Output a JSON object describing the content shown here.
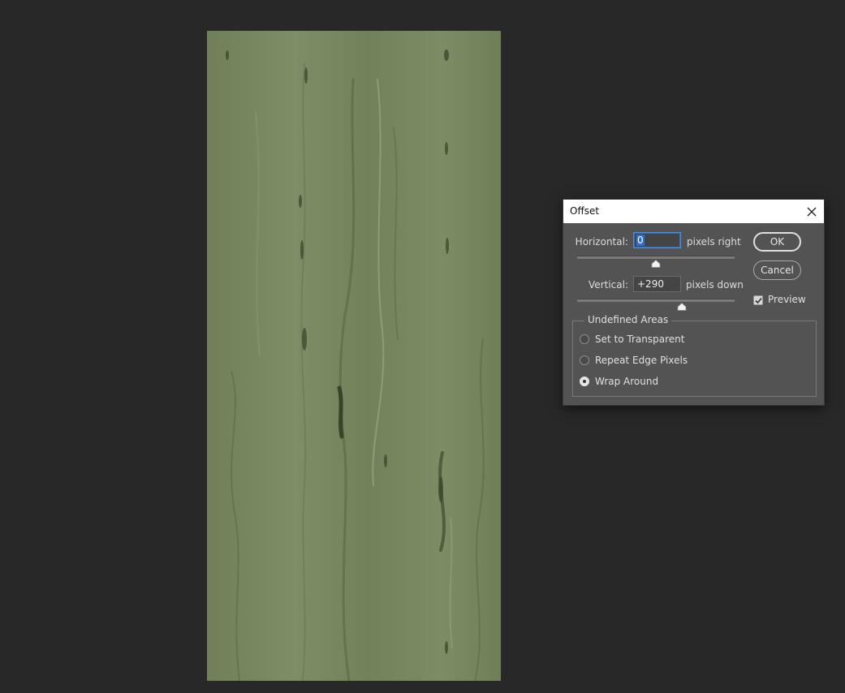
{
  "dialog": {
    "title": "Offset",
    "horizontal": {
      "label": "Horizontal:",
      "value": "0",
      "unit": "pixels right"
    },
    "vertical": {
      "label": "Vertical:",
      "value": "+290",
      "unit": "pixels down"
    },
    "ok_label": "OK",
    "cancel_label": "Cancel",
    "preview": {
      "label": "Preview",
      "checked": true
    },
    "undefined_areas": {
      "title": "Undefined Areas",
      "options": [
        {
          "label": "Set to Transparent",
          "selected": false
        },
        {
          "label": "Repeat Edge Pixels",
          "selected": false
        },
        {
          "label": "Wrap Around",
          "selected": true
        }
      ]
    }
  },
  "icons": {
    "close": "close-icon",
    "check": "checkmark-icon",
    "slider_thumb": "slider-thumb-icon"
  },
  "colors": {
    "workspace": "#282828",
    "canvas_texture": "#77875f",
    "dialog_bg": "#535353",
    "focus_accent": "#4a90e2"
  }
}
